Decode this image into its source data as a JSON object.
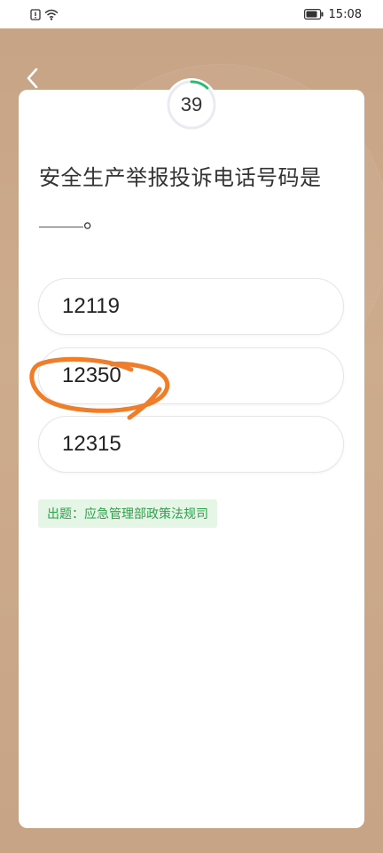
{
  "status_bar": {
    "time": "15:08"
  },
  "timer": {
    "value": "39",
    "progress_fraction": 0.12,
    "track_color": "#e8ebf0",
    "progress_color": "#2bbd6e"
  },
  "question": {
    "text": "安全生产举报投诉电话号码是",
    "suffix": "。"
  },
  "options": [
    {
      "label": "12119"
    },
    {
      "label": "12350"
    },
    {
      "label": "12315"
    }
  ],
  "source": {
    "text": "出题：应急管理部政策法规司"
  },
  "colors": {
    "background": "#c9a788",
    "card": "#ffffff",
    "source_bg": "#e5f5e6",
    "source_text": "#2da34a",
    "annotation": "#f07d2a"
  }
}
